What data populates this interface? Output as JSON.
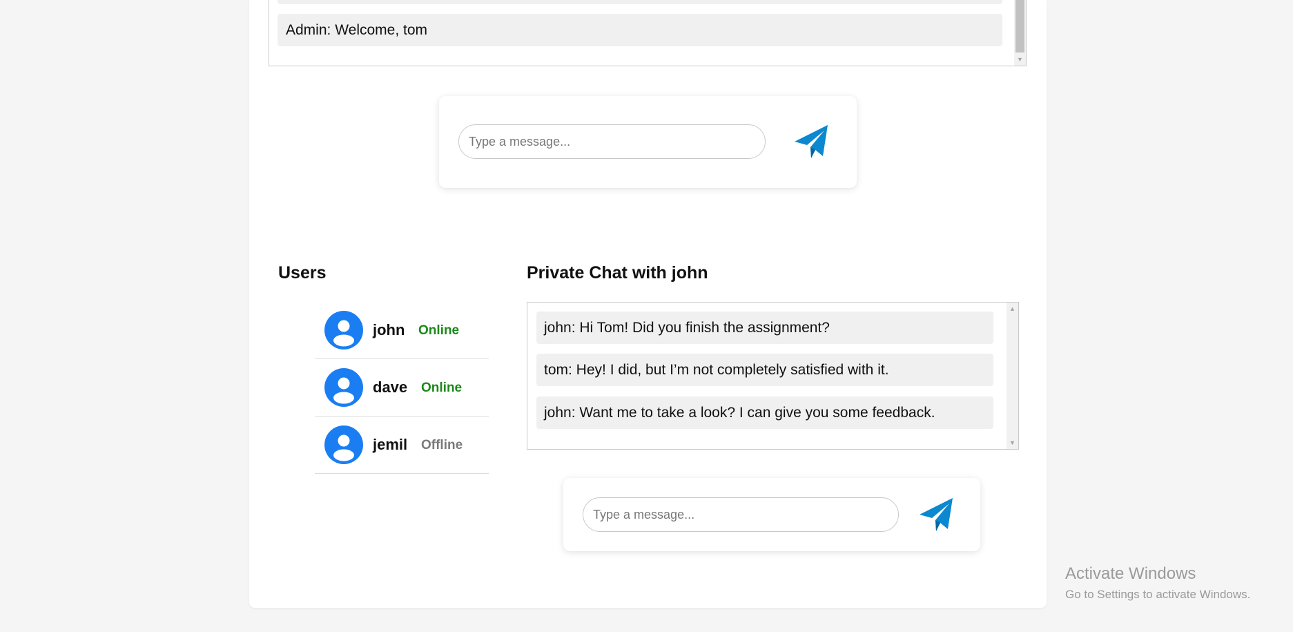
{
  "public_chat": {
    "messages": [
      "Admin: Welcome, tom"
    ],
    "composer": {
      "placeholder": "Type a message...",
      "value": ""
    }
  },
  "users_panel": {
    "title": "Users",
    "users": [
      {
        "name": "john",
        "status": "Online"
      },
      {
        "name": "dave",
        "status": "Online"
      },
      {
        "name": "jemil",
        "status": "Offline"
      }
    ]
  },
  "private_chat": {
    "title": "Private Chat with john",
    "messages": [
      "john: Hi Tom! Did you finish the assignment?",
      "tom: Hey! I did, but I’m not completely satisfied with it.",
      "john: Want me to take a look? I can give you some feedback."
    ],
    "composer": {
      "placeholder": "Type a message...",
      "value": ""
    }
  },
  "icons": {
    "send": "paper-plane-icon",
    "avatar": "user-avatar-icon"
  },
  "colors": {
    "send_icon": "#0b88d0",
    "avatar_bg": "#1a7ef2",
    "online": "#1a8a1a",
    "offline": "#7a7a7a",
    "message_bg": "#f0f0f0"
  },
  "watermark": {
    "title": "Activate Windows",
    "subtitle": "Go to Settings to activate Windows."
  }
}
